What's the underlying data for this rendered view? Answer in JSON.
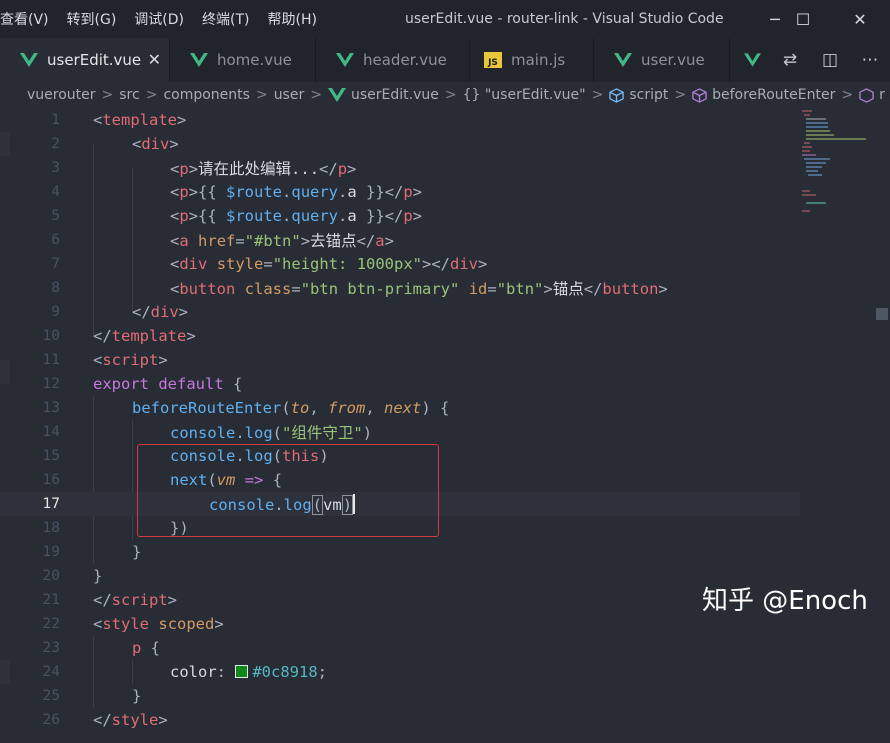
{
  "menu": [
    "查看(V)",
    "转到(G)",
    "调试(D)",
    "终端(T)",
    "帮助(H)"
  ],
  "window_title": "userEdit.vue - router-link - Visual Studio Code",
  "window_controls": {
    "minimize": "─",
    "maximize": "☐",
    "close": "✕"
  },
  "tabs": [
    {
      "label": "userEdit.vue",
      "icon": "vue-icon",
      "active": true,
      "close": "✕"
    },
    {
      "label": "home.vue",
      "icon": "vue-icon"
    },
    {
      "label": "header.vue",
      "icon": "vue-icon"
    },
    {
      "label": "main.js",
      "icon": "js-icon",
      "icon_text": "JS"
    },
    {
      "label": "user.vue",
      "icon": "vue-icon"
    }
  ],
  "tab_actions": [
    "compare-changes-icon",
    "split-editor-icon",
    "more-actions-icon"
  ],
  "tab_action_glyphs": [
    "⇄",
    "◫",
    "⋯"
  ],
  "breadcrumb": {
    "items": [
      "vuerouter",
      "src",
      "components",
      "user",
      "userEdit.vue",
      "{} \"userEdit.vue\"",
      "script",
      "beforeRouteEnter",
      "r"
    ],
    "separator": ">"
  },
  "editor": {
    "current_line": 17,
    "line_numbers": [
      "1",
      "2",
      "3",
      "4",
      "5",
      "6",
      "7",
      "8",
      "9",
      "10",
      "11",
      "12",
      "13",
      "14",
      "15",
      "16",
      "17",
      "18",
      "19",
      "20",
      "21",
      "22",
      "23",
      "24",
      "25",
      "26"
    ],
    "code": {
      "l1": [
        "<",
        "template",
        ">"
      ],
      "l2": [
        "<",
        "div",
        ">"
      ],
      "l3": [
        "<",
        "p",
        ">",
        "请在此处编辑...",
        "</",
        "p",
        ">"
      ],
      "l4": [
        "<",
        "p",
        ">{{ ",
        "$route",
        ".",
        "query",
        ".",
        "a",
        " }}</",
        "p",
        ">"
      ],
      "l5": [
        "<",
        "p",
        ">{{ ",
        "$route",
        ".",
        "query",
        ".",
        "a",
        " }}</",
        "p",
        ">"
      ],
      "l6": [
        "<",
        "a",
        " ",
        "href",
        "=",
        "\"#btn\"",
        ">",
        "去锚点",
        "</",
        "a",
        ">"
      ],
      "l7": [
        "<",
        "div",
        " ",
        "style",
        "=",
        "\"height: 1000px\"",
        "></",
        "div",
        ">"
      ],
      "l8": [
        "<",
        "button",
        " ",
        "class",
        "=",
        "\"btn btn-primary\"",
        " ",
        "id",
        "=",
        "\"btn\"",
        ">",
        "锚点",
        "</",
        "button",
        ">"
      ],
      "l9": [
        "</",
        "div",
        ">"
      ],
      "l10": [
        "</",
        "template",
        ">"
      ],
      "l11": [
        "<",
        "script",
        ">"
      ],
      "l12": [
        "export",
        " ",
        "default",
        " {"
      ],
      "l13": [
        "beforeRouteEnter",
        "(",
        "to",
        ", ",
        "from",
        ", ",
        "next",
        ") {"
      ],
      "l14": [
        "console",
        ".",
        "log",
        "(",
        "\"组件守卫\"",
        ")"
      ],
      "l15": [
        "console",
        ".",
        "log",
        "(",
        "this",
        ")"
      ],
      "l16": [
        "next",
        "(",
        "vm",
        " ",
        "=>",
        " {"
      ],
      "l17": [
        "console",
        ".",
        "log",
        "(",
        "vm",
        ")"
      ],
      "l18": [
        "})"
      ],
      "l19": [
        "}"
      ],
      "l20": [
        "}"
      ],
      "l21": [
        "</",
        "script",
        ">"
      ],
      "l22": [
        "<",
        "style",
        " ",
        "scoped",
        ">"
      ],
      "l23": [
        "p",
        " {"
      ],
      "l24": [
        "color",
        ": ",
        "#0c8918",
        ";"
      ],
      "l25": [
        "}"
      ],
      "l26": [
        "</",
        "style",
        ">"
      ]
    },
    "swatch_color": "#0c8918"
  },
  "watermark": "知乎 @Enoch"
}
